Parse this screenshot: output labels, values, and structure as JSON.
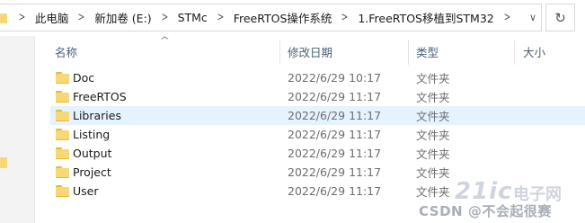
{
  "address_bar": {
    "breadcrumbs": [
      "此电脑",
      "新加卷 (E:)",
      "STMc",
      "FreeRTOS操作系统",
      "1.FreeRTOS移植到STM32"
    ]
  },
  "columns": {
    "name": "名称",
    "date": "修改日期",
    "type": "类型",
    "size": "大小"
  },
  "files": [
    {
      "name": "Doc",
      "date": "2022/6/29 10:17",
      "type": "文件夹",
      "selected": false
    },
    {
      "name": "FreeRTOS",
      "date": "2022/6/29 11:17",
      "type": "文件夹",
      "selected": false
    },
    {
      "name": "Libraries",
      "date": "2022/6/29 11:17",
      "type": "文件夹",
      "selected": true
    },
    {
      "name": "Listing",
      "date": "2022/6/29 11:17",
      "type": "文件夹",
      "selected": false
    },
    {
      "name": "Output",
      "date": "2022/6/29 11:17",
      "type": "文件夹",
      "selected": false
    },
    {
      "name": "Project",
      "date": "2022/6/29 11:17",
      "type": "文件夹",
      "selected": false
    },
    {
      "name": "User",
      "date": "2022/6/29 11:17",
      "type": "文件夹",
      "selected": false
    }
  ],
  "watermark": {
    "logo": "21ic",
    "site": "电子网",
    "credit": "CSDN @不会起很赛"
  },
  "colors": {
    "folder": "#f8d775",
    "selection": "#e5f3ff",
    "header_text": "#4c607a"
  }
}
